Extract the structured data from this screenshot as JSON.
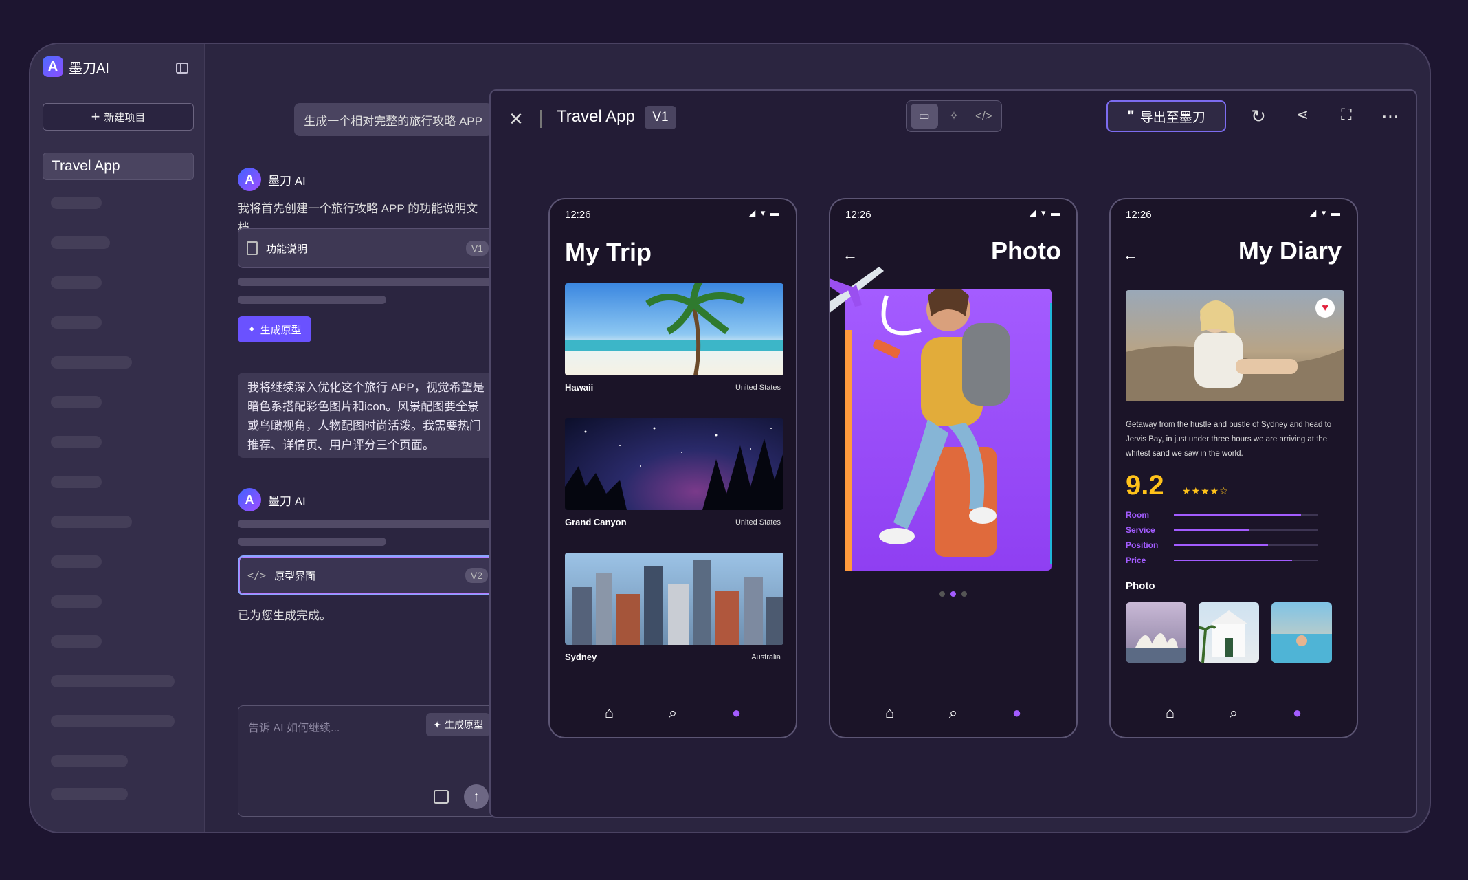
{
  "app": {
    "name": "墨刀AI"
  },
  "sidebar": {
    "new_project": "新建项目",
    "projects": [
      {
        "label": "Travel App"
      }
    ]
  },
  "chat": {
    "user_message": "生成一个相对完整的旅行攻略 APP",
    "ai_name": "墨刀 AI",
    "ai_intro": "我将首先创建一个旅行攻略 APP 的功能说明文档。",
    "doc_card": {
      "label": "功能说明",
      "version": "V1"
    },
    "generate_button": "生成原型",
    "request_text": "我将继续深入优化这个旅行 APP，视觉希望是暗色系搭配彩色图片和icon。风景配图要全景或鸟瞰视角，人物配图时尚活泼。我需要热门推荐、详情页、用户评分三个页面。",
    "ai_name_2": "墨刀 AI",
    "proto_card": {
      "label": "原型界面",
      "version": "V2"
    },
    "done_text": "已为您生成完成。",
    "input_placeholder": "告诉 AI 如何继续...",
    "input_generate": "生成原型"
  },
  "preview": {
    "title": "Travel App",
    "version": "V1",
    "export_label": "导出至墨刀"
  },
  "phones": {
    "trip": {
      "time": "12:26",
      "title": "My Trip",
      "destinations": [
        {
          "name": "Hawaii",
          "country": "United States"
        },
        {
          "name": "Grand Canyon",
          "country": "United States"
        },
        {
          "name": "Sydney",
          "country": "Australia"
        }
      ]
    },
    "photo": {
      "time": "12:26",
      "title": "Photo",
      "active_dot": 2
    },
    "diary": {
      "time": "12:26",
      "title": "My Diary",
      "text": "Getaway from the hustle and bustle of Sydney and head to Jervis Bay, in just under three hours we are arriving at the whitest sand we saw in the world.",
      "score": "9.2",
      "stars": 4,
      "ratings": [
        {
          "label": "Room",
          "value": 0.88
        },
        {
          "label": "Service",
          "value": 0.52
        },
        {
          "label": "Position",
          "value": 0.65
        },
        {
          "label": "Price",
          "value": 0.82
        }
      ],
      "photo_label": "Photo"
    }
  },
  "colors": {
    "accent": "#a35cff",
    "score": "#ffc21a",
    "brand": "#6a52ff"
  }
}
